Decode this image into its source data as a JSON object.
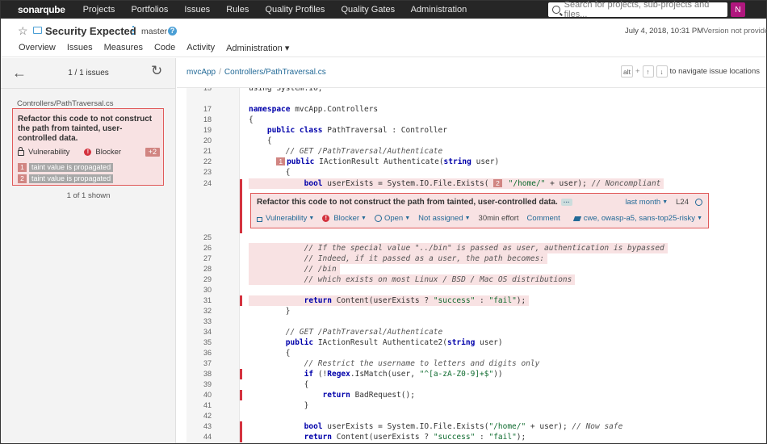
{
  "topbar": {
    "logo_main": "sonar",
    "logo_accent": "qube",
    "nav": [
      "Projects",
      "Portfolios",
      "Issues",
      "Rules",
      "Quality Profiles",
      "Quality Gates",
      "Administration"
    ],
    "search_placeholder": "Search for projects, sub-projects and files...",
    "avatar_letter": "N"
  },
  "project": {
    "name": "Security Expected",
    "branch": "master",
    "help": "?",
    "date": "July 4, 2018, 10:31 PM",
    "version": "Version not provided",
    "tabs": [
      "Overview",
      "Issues",
      "Measures",
      "Code",
      "Activity",
      "Administration ▾"
    ]
  },
  "sidebar": {
    "count": "1 / 1 issues",
    "file": "Controllers/PathTraversal.cs",
    "issue": {
      "message": "Refactor this code to not construct the path from tainted, user-controlled data.",
      "type": "Vulnerability",
      "severity": "Blocker",
      "extra": "+2",
      "flows": [
        {
          "num": "1",
          "text": "taint value is propagated"
        },
        {
          "num": "2",
          "text": "taint value is propagated"
        }
      ]
    },
    "shown": "1 of 1 shown"
  },
  "main": {
    "breadcrumb": [
      "mvcApp",
      "Controllers/PathTraversal.cs"
    ],
    "nav_keys": [
      "alt",
      "↑",
      "↓"
    ],
    "nav_hint": "to navigate issue locations",
    "inline_issue": {
      "message": "Refactor this code to not construct the path from tainted, user-controlled data.",
      "dots": "···",
      "when": "last month",
      "line": "L24",
      "type": "Vulnerability",
      "severity": "Blocker",
      "status": "Open",
      "assignee": "Not assigned",
      "effort": "30min effort",
      "comment": "Comment",
      "tags": "cwe, owasp-a5, sans-top25-risky"
    }
  },
  "colors": {
    "topbar": "#262626",
    "accent": "#4b9fd5",
    "issue_bg": "#f8e2e3",
    "issue_border": "#e05a5a",
    "blocker": "#d4333f"
  }
}
